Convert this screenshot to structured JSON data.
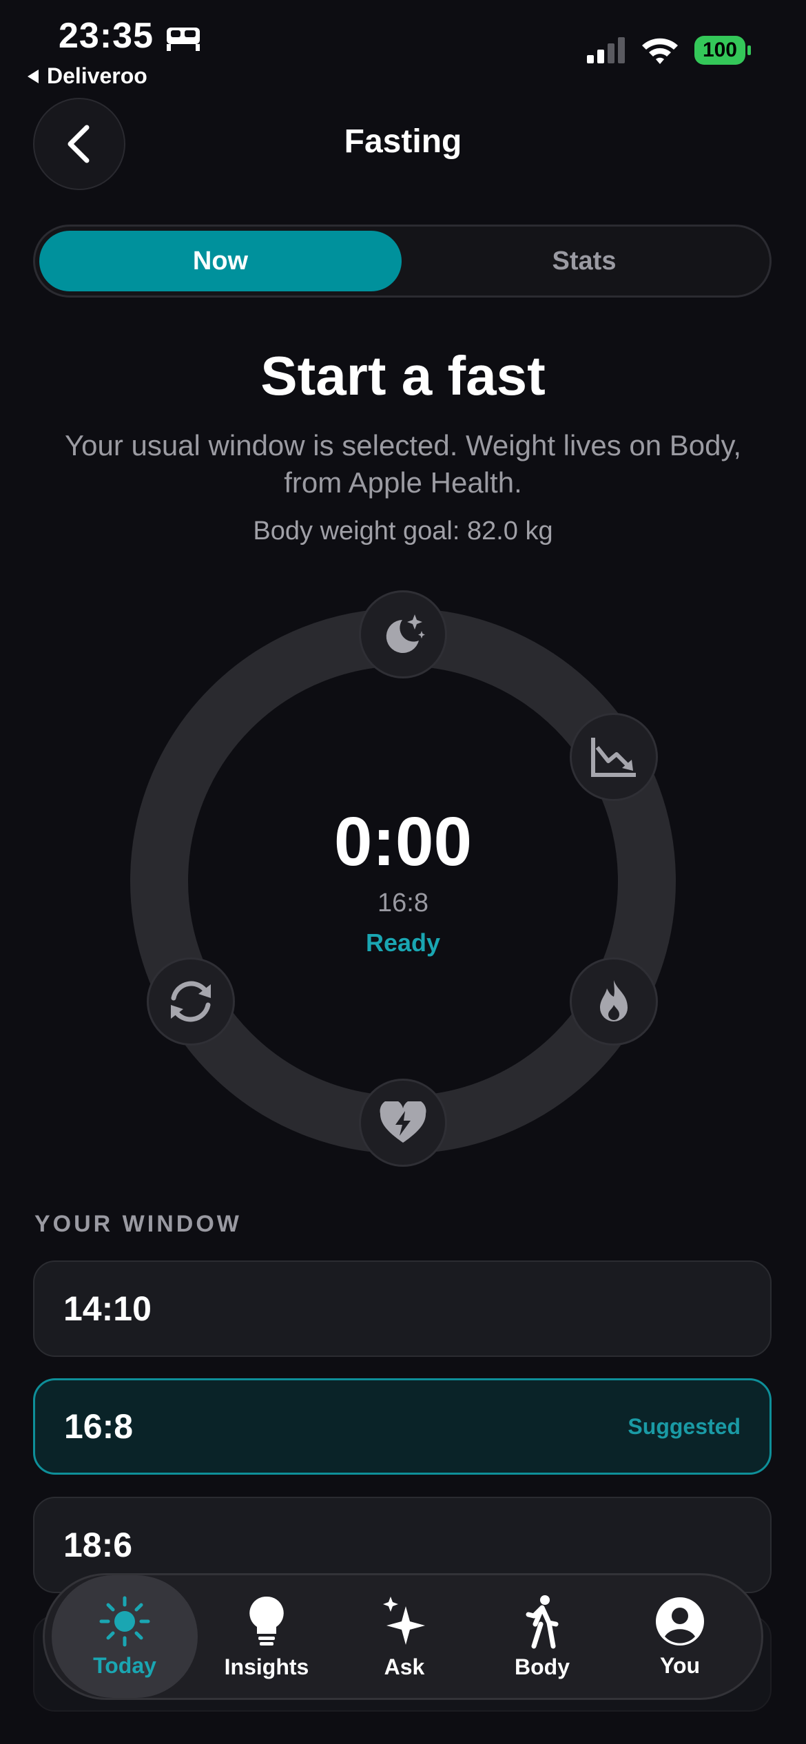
{
  "status_bar": {
    "time": "23:35",
    "back_app": "Deliveroo",
    "battery": "100"
  },
  "header": {
    "title": "Fasting"
  },
  "segmented": {
    "now": "Now",
    "stats": "Stats"
  },
  "main": {
    "heading": "Start a fast",
    "subtitle": "Your usual window is selected. Weight lives on Body, from Apple Health.",
    "goal": "Body weight goal: 82.0 kg"
  },
  "ring": {
    "timer": "0:00",
    "ratio": "16:8",
    "status": "Ready",
    "nodes": [
      "moon-stars-icon",
      "chart-down-icon",
      "flame-icon",
      "heart-bolt-icon",
      "refresh-icon"
    ]
  },
  "window": {
    "section_label": "YOUR WINDOW",
    "options": [
      {
        "label": "14:10",
        "tag": ""
      },
      {
        "label": "16:8",
        "tag": "Suggested"
      },
      {
        "label": "18:6",
        "tag": ""
      }
    ]
  },
  "tabs": [
    {
      "label": "Today",
      "icon": "sun-icon",
      "active": true
    },
    {
      "label": "Insights",
      "icon": "lightbulb-icon",
      "active": false
    },
    {
      "label": "Ask",
      "icon": "sparkles-icon",
      "active": false
    },
    {
      "label": "Body",
      "icon": "walk-icon",
      "active": false
    },
    {
      "label": "You",
      "icon": "person-icon",
      "active": false
    }
  ],
  "colors": {
    "accent": "#00919c",
    "accent_text": "#1aa6b2",
    "background": "#0d0d12"
  }
}
